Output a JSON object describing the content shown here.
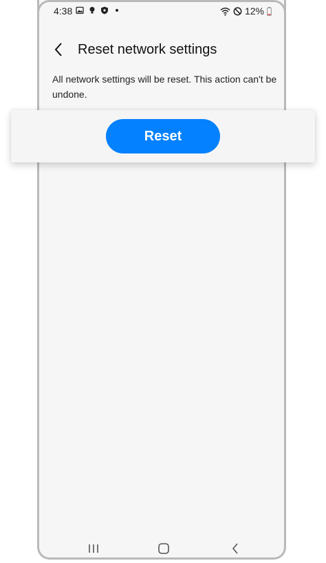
{
  "status_bar": {
    "time": "4:38",
    "battery": "12%"
  },
  "header": {
    "title": "Reset network settings"
  },
  "content": {
    "description": "All network settings will be reset. This action can't be undone."
  },
  "actions": {
    "reset_label": "Reset"
  },
  "colors": {
    "accent": "#0381fe",
    "background": "#f6f6f6"
  },
  "icons": {
    "status_left": [
      "gallery-icon",
      "bulb-icon",
      "shield-icon",
      "dot-icon"
    ],
    "status_right": [
      "wifi-icon",
      "do-not-disturb-icon",
      "battery-icon"
    ],
    "nav": [
      "recents-icon",
      "home-icon",
      "back-icon"
    ]
  }
}
